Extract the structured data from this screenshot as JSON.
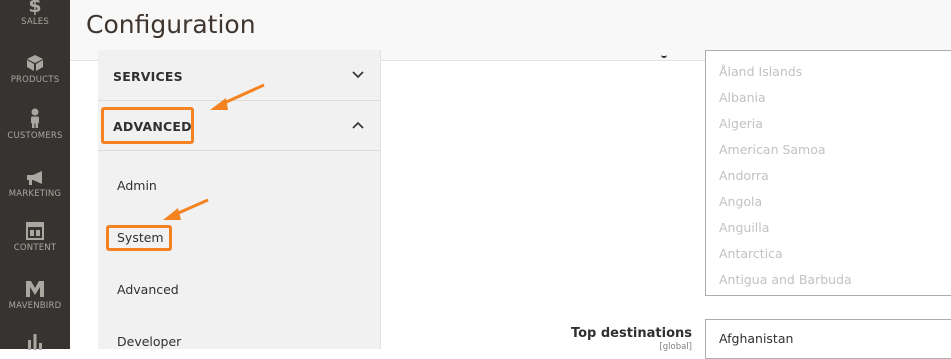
{
  "nav": {
    "items": [
      {
        "label": "Sales",
        "icon": "dollar-icon"
      },
      {
        "label": "Products",
        "icon": "cube-icon"
      },
      {
        "label": "Customers",
        "icon": "person-icon"
      },
      {
        "label": "Marketing",
        "icon": "megaphone-icon"
      },
      {
        "label": "Content",
        "icon": "layout-icon"
      },
      {
        "label": "Mavenbird",
        "icon": "mavenbird-logo-icon"
      },
      {
        "label": "",
        "icon": "bar-chart-icon"
      }
    ]
  },
  "header": {
    "title": "Configuration"
  },
  "config_tabs": {
    "services_label": "SERVICES",
    "advanced_label": "ADVANCED",
    "items": [
      "Admin",
      "System",
      "Advanced",
      "Developer"
    ]
  },
  "country_list": {
    "options": [
      "Åland Islands",
      "Albania",
      "Algeria",
      "American Samoa",
      "Andorra",
      "Angola",
      "Anguilla",
      "Antarctica",
      "Antigua and Barbuda"
    ]
  },
  "top_destinations": {
    "label": "Top destinations",
    "scope": "[global]",
    "selected": "Afghanistan"
  },
  "colors": {
    "accent": "#f58220",
    "nav_bg": "#373330",
    "title": "#41362f"
  }
}
